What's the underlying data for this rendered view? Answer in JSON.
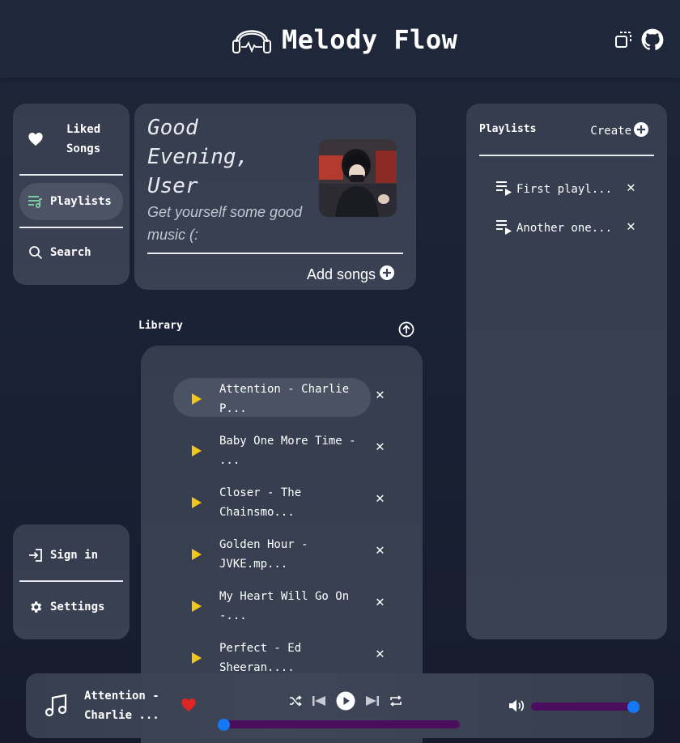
{
  "header": {
    "title": "Melody Flow",
    "icons": [
      "headphones-icon",
      "copy-icon",
      "github-icon"
    ]
  },
  "nav": {
    "liked": "Liked\nSongs",
    "playlists": "Playlists",
    "search": "Search",
    "signin": "Sign in",
    "settings": "Settings"
  },
  "greeting": {
    "title": "Good Evening, User",
    "subtitle": "Get yourself some good music (:",
    "add_songs": "Add songs"
  },
  "library": {
    "label": "Library",
    "songs": [
      "Attention - Charlie\nP...",
      "Baby One More Time -\n...",
      "Closer - The\nChainsmo...",
      "Golden Hour -\nJVKE.mp...",
      "My Heart Will Go On\n-...",
      "Perfect - Ed\nSheeran...."
    ],
    "active_index": 0
  },
  "playlists": {
    "label": "Playlists",
    "create": "Create",
    "items": [
      "First playl...",
      "Another one..."
    ]
  },
  "player": {
    "now_playing": "Attention -\nCharlie ...",
    "liked": true,
    "progress": 0.0,
    "volume": 1.0
  },
  "colors": {
    "accent_play": "#f5c518",
    "heart": "#e02424",
    "track": "#4b0e5e",
    "knob": "#1579f5",
    "playlists_icon": "#7de0a8"
  }
}
